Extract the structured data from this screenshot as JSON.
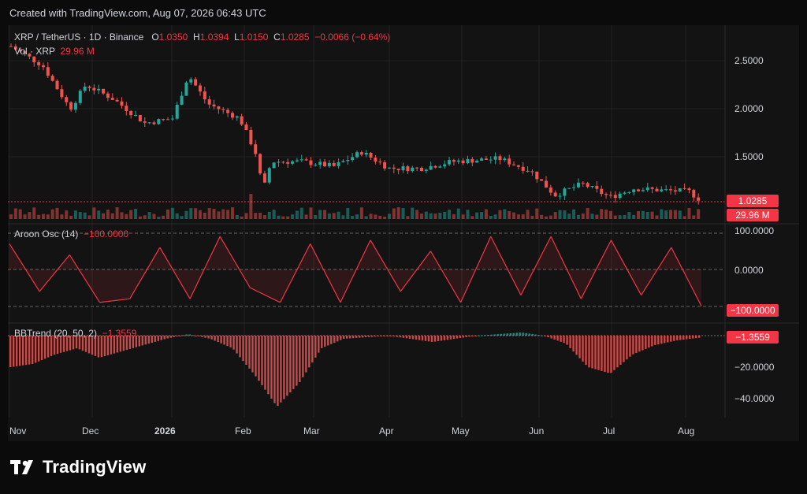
{
  "header": {
    "caption": "Created with TradingView.com, Aug 07, 2026 06:43 UTC"
  },
  "legend": {
    "symbol": "XRP / TetherUS · 1D · Binance",
    "o_label": "O",
    "o_value": "1.0350",
    "h_label": "H",
    "h_value": "1.0394",
    "l_label": "L",
    "l_value": "1.0150",
    "c_label": "C",
    "c_value": "1.0285",
    "change": "−0.0066 (−0.64%)",
    "vol_label": "Vol · XRP",
    "vol_value": "29.96 M"
  },
  "indicators": {
    "aroon_label": "Aroon Osc (14)",
    "aroon_value": "−100.0000",
    "bb_label": "BBTrend (20, 50, 2)",
    "bb_value": "−1.3559"
  },
  "price_tags": {
    "price": "1.0285",
    "volume": "29.96 M",
    "aroon": "−100.0000",
    "bbtrend": "−1.3559"
  },
  "axis_labels": {
    "price": [
      "2.5000",
      "2.0000",
      "1.5000"
    ],
    "aroon": [
      "100.0000",
      "0.0000"
    ],
    "bbtrend": [
      "−20.0000",
      "−40.0000"
    ]
  },
  "months": [
    "Nov",
    "Dec",
    "2026",
    "Feb",
    "Mar",
    "Apr",
    "May",
    "Jun",
    "Jul",
    "Aug"
  ],
  "brand": {
    "name": "TradingView"
  },
  "colors": {
    "up": "#26a69a",
    "down": "#ef5350",
    "tag": "#f23645",
    "aroon_up": "#4caf50",
    "aroon_down": "#f23645"
  },
  "chart_data": [
    {
      "type": "line",
      "title": "XRP / TetherUS · 1D · Binance",
      "x": [
        "Nov",
        "Dec",
        "2026",
        "Feb",
        "Mar",
        "Apr",
        "May",
        "Jun",
        "Jul",
        "Aug"
      ],
      "series": [
        {
          "name": "XRP / TetherUS",
          "values": [
            2.65,
            2.2,
            1.85,
            2.35,
            1.4,
            1.45,
            1.4,
            1.5,
            1.1,
            1.08,
            1.03
          ]
        }
      ],
      "ylim": [
        0.9,
        2.7
      ],
      "last": {
        "open": 1.035,
        "high": 1.0394,
        "low": 1.015,
        "close": 1.0285
      },
      "volume_last": "29.96 M"
    },
    {
      "type": "line",
      "title": "Aroon Osc (14)",
      "ylim": [
        -100,
        100
      ],
      "values": [
        70,
        -60,
        40,
        -90,
        -80,
        60,
        -80,
        90,
        -50,
        -90,
        70,
        -90,
        80,
        -60,
        50,
        -90,
        90,
        -70,
        90,
        -80,
        80,
        -70,
        60,
        -100
      ]
    },
    {
      "type": "bar",
      "title": "BBTrend (20, 50, 2)",
      "ylim": [
        -48,
        3
      ],
      "values": [
        -20,
        -18,
        -12,
        -8,
        -14,
        -10,
        -6,
        -2,
        1,
        -2,
        -8,
        -25,
        -45,
        -30,
        -8,
        -2,
        -1,
        0,
        -2,
        -4,
        -2,
        0,
        1,
        2,
        0,
        -5,
        -20,
        -24,
        -12,
        -6,
        -3,
        -1.3559
      ]
    }
  ]
}
